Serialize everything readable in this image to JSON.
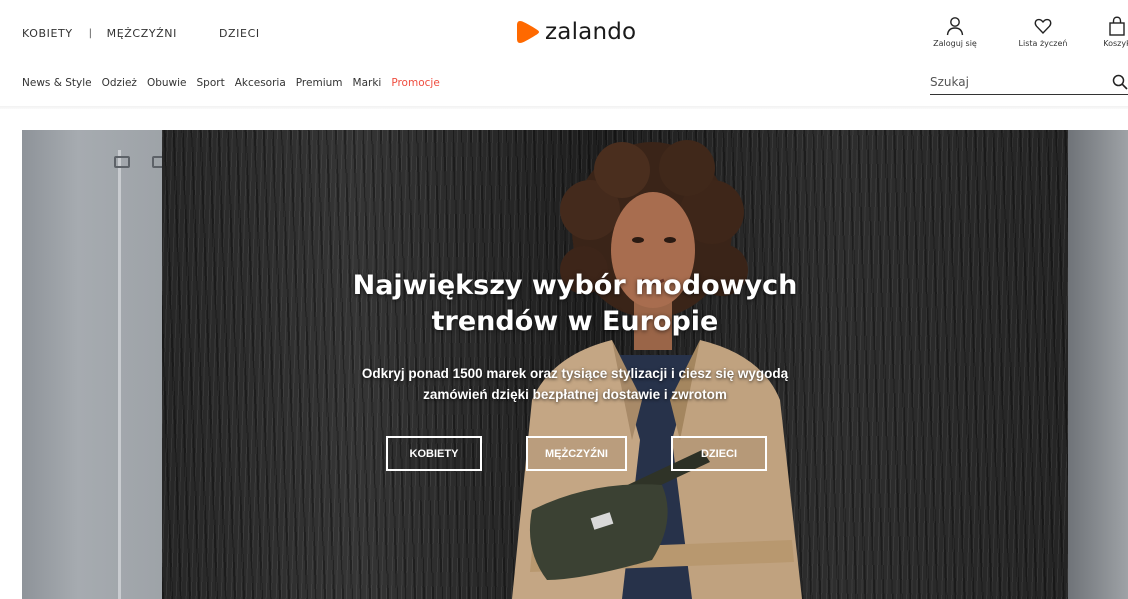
{
  "header": {
    "gender_nav": {
      "women": "KOBIETY",
      "separator": "|",
      "men": "MĘŻCZYŹNI",
      "kids": "DZIECI"
    },
    "logo": {
      "text": "zalando",
      "color": "#ff6900"
    },
    "user_actions": {
      "login": "Zaloguj się",
      "wishlist": "Lista życzeń",
      "cart": "Koszyk"
    },
    "categories": [
      "News & Style",
      "Odzież",
      "Obuwie",
      "Sport",
      "Akcesoria",
      "Premium",
      "Marki",
      "Promocje"
    ],
    "promo_color": "#ef4d3f",
    "search": {
      "placeholder": "Szukaj",
      "icon": "search-icon"
    }
  },
  "hero": {
    "title_line1": "Największy wybór modowych",
    "title_line2": "trendów w Europie",
    "subtitle_line1": "Odkryj ponad 1500 marek oraz tysiące stylizacji i ciesz się wygodą",
    "subtitle_line2": "zamówień dzięki bezpłatnej dostawie i zwrotom",
    "buttons": {
      "women": "KOBIETY",
      "men": "MĘŻCZYŹNI",
      "kids": "DZIECI"
    }
  }
}
